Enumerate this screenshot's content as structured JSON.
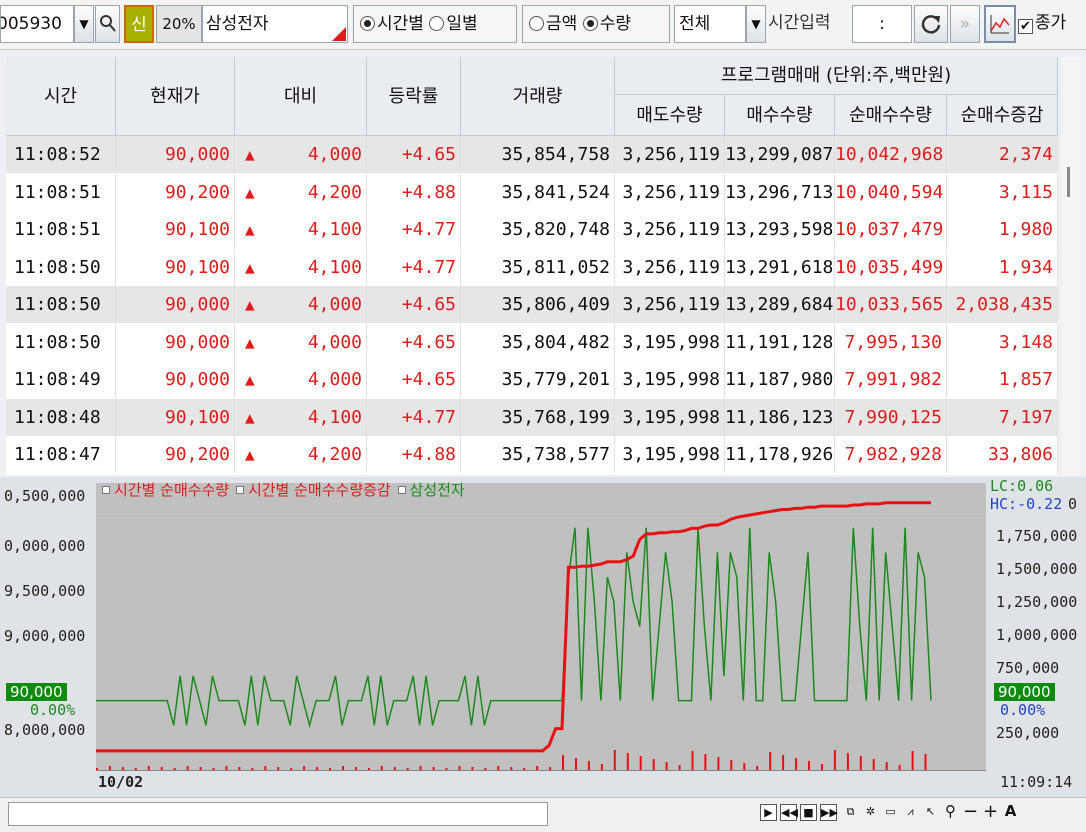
{
  "toolbar": {
    "code": "005930",
    "credit_label": "신",
    "margin": "20%",
    "stock_name": "삼성전자",
    "mode_time": "시간별",
    "mode_day": "일별",
    "unit_amount": "금액",
    "unit_qty": "수량",
    "filter": "전체",
    "time_input_label": "시간입력",
    "time_value": " : ",
    "close_label": "종가"
  },
  "grid": {
    "headers": {
      "time": "시간",
      "price": "현재가",
      "change": "대비",
      "rate": "등락률",
      "volume": "거래량",
      "program": "프로그램매매 (단위:주,백만원)",
      "sell_qty": "매도수량",
      "buy_qty": "매수수량",
      "net_qty": "순매수수량",
      "net_delta": "순매수증감"
    },
    "rows": [
      {
        "time": "11:08:52",
        "price": "90,000",
        "change": "4,000",
        "rate": "+4.65",
        "volume": "35,854,758",
        "sell": "3,256,119",
        "buy": "13,299,087",
        "net": "10,042,968",
        "delta": "2,374"
      },
      {
        "time": "11:08:51",
        "price": "90,200",
        "change": "4,200",
        "rate": "+4.88",
        "volume": "35,841,524",
        "sell": "3,256,119",
        "buy": "13,296,713",
        "net": "10,040,594",
        "delta": "3,115"
      },
      {
        "time": "11:08:51",
        "price": "90,100",
        "change": "4,100",
        "rate": "+4.77",
        "volume": "35,820,748",
        "sell": "3,256,119",
        "buy": "13,293,598",
        "net": "10,037,479",
        "delta": "1,980"
      },
      {
        "time": "11:08:50",
        "price": "90,100",
        "change": "4,100",
        "rate": "+4.77",
        "volume": "35,811,052",
        "sell": "3,256,119",
        "buy": "13,291,618",
        "net": "10,035,499",
        "delta": "1,934"
      },
      {
        "time": "11:08:50",
        "price": "90,000",
        "change": "4,000",
        "rate": "+4.65",
        "volume": "35,806,409",
        "sell": "3,256,119",
        "buy": "13,289,684",
        "net": "10,033,565",
        "delta": "2,038,435"
      },
      {
        "time": "11:08:50",
        "price": "90,000",
        "change": "4,000",
        "rate": "+4.65",
        "volume": "35,804,482",
        "sell": "3,195,998",
        "buy": "11,191,128",
        "net": "7,995,130",
        "delta": "3,148"
      },
      {
        "time": "11:08:49",
        "price": "90,000",
        "change": "4,000",
        "rate": "+4.65",
        "volume": "35,779,201",
        "sell": "3,195,998",
        "buy": "11,187,980",
        "net": "7,991,982",
        "delta": "1,857"
      },
      {
        "time": "11:08:48",
        "price": "90,100",
        "change": "4,100",
        "rate": "+4.77",
        "volume": "35,768,199",
        "sell": "3,195,998",
        "buy": "11,186,123",
        "net": "7,990,125",
        "delta": "7,197"
      },
      {
        "time": "11:08:47",
        "price": "90,200",
        "change": "4,200",
        "rate": "+4.88",
        "volume": "35,738,577",
        "sell": "3,195,998",
        "buy": "11,178,926",
        "net": "7,982,928",
        "delta": "33,806"
      }
    ]
  },
  "chart": {
    "legend": [
      "시간별 순매수수량",
      "시간별 순매수수량증감",
      "삼성전자"
    ],
    "left_axis": [
      "0,500,000",
      "0,000,000",
      "9,500,000",
      "9,000,000",
      "8,000,000"
    ],
    "right_axis": [
      "1,750,000",
      "1,500,000",
      "1,250,000",
      "1,000,000",
      "750,000",
      "250,000"
    ],
    "lc": "LC:0.06",
    "hc": "HC:-0.22",
    "right_top": "0",
    "price_tag": "90,000",
    "pct_tag": "0.00%",
    "date_label": "10/02",
    "time_label": "11:09:14",
    "colors": {
      "net": "#e81010",
      "price": "#1b8a1b",
      "tag": "#0f8c10"
    }
  },
  "chart_data": {
    "type": "line",
    "title": "",
    "series": [
      {
        "name": "삼성전자",
        "values": [
          89700,
          89700,
          89700,
          89700,
          89700,
          89700,
          89700,
          89700,
          89700,
          89700,
          89700,
          89700,
          89600,
          89800,
          89600,
          89800,
          89700,
          89600,
          89800,
          89700,
          89700,
          89700,
          89700,
          89600,
          89800,
          89600,
          89800,
          89700,
          89700,
          89700,
          89600,
          89800,
          89700,
          89600,
          89700,
          89700,
          89700,
          89800,
          89600,
          89700,
          89700,
          89700,
          89800,
          89600,
          89800,
          89600,
          89700,
          89700,
          89700,
          89800,
          89600,
          89800,
          89600,
          89700,
          89700,
          89700,
          89700,
          89800,
          89600,
          89800,
          89600,
          89700,
          89700,
          89700,
          89700,
          89700,
          89700,
          89700,
          89700,
          89700,
          89700,
          89700,
          89700,
          90200,
          90400,
          89700,
          90400,
          90100,
          89700,
          90200,
          90100,
          89700,
          90300,
          90100,
          90000,
          90400,
          89700,
          90000,
          90300,
          90100,
          89700,
          89700,
          89700,
          90400,
          90000,
          89700,
          90300,
          89800,
          90300,
          90200,
          89700,
          90400,
          89700,
          89700,
          90300,
          90100,
          89700,
          89700,
          89700,
          90000,
          90300,
          89700,
          89700,
          89700,
          89700,
          89700,
          89700,
          90400,
          90000,
          89700,
          90400,
          89700,
          90300,
          90000,
          89700,
          90400,
          89700,
          90300,
          90200,
          89700
        ]
      },
      {
        "name": "시간별 순매수수량",
        "values": [
          8300000,
          8300000,
          8300000,
          8300000,
          8300000,
          8300000,
          8300000,
          8300000,
          8300000,
          8300000,
          8300000,
          8300000,
          8300000,
          8300000,
          8300000,
          8300000,
          8300000,
          8300000,
          8300000,
          8300000,
          8300000,
          8300000,
          8300000,
          8300000,
          8300000,
          8300000,
          8300000,
          8300000,
          8300000,
          8300000,
          8300000,
          8300000,
          8300000,
          8300000,
          8300000,
          8300000,
          8300000,
          8300000,
          8300000,
          8300000,
          8300000,
          8300000,
          8300000,
          8300000,
          8300000,
          8300000,
          8300000,
          8300000,
          8300000,
          8300000,
          8300000,
          8300000,
          8300000,
          8300000,
          8300000,
          8300000,
          8300000,
          8300000,
          8300000,
          8300000,
          8300000,
          8300000,
          8300000,
          8300000,
          8300000,
          8300000,
          8300000,
          8300000,
          8300000,
          8300000,
          8350000,
          8500000,
          8500000,
          9950000,
          9950000,
          9960000,
          9960000,
          9970000,
          9980000,
          10000000,
          10000000,
          10000000,
          10020000,
          10050000,
          10200000,
          10250000,
          10250000,
          10260000,
          10260000,
          10270000,
          10270000,
          10280000,
          10300000,
          10300000,
          10320000,
          10330000,
          10330000,
          10350000,
          10380000,
          10400000,
          10410000,
          10420000,
          10430000,
          10440000,
          10450000,
          10460000,
          10470000,
          10470000,
          10480000,
          10480000,
          10490000,
          10490000,
          10500000,
          10500000,
          10500000,
          10500000,
          10500000,
          10510000,
          10510000,
          10520000,
          10520000,
          10520000,
          10530000,
          10530000,
          10530000,
          10530000,
          10530000,
          10530000,
          10530000,
          10530000
        ]
      }
    ]
  }
}
